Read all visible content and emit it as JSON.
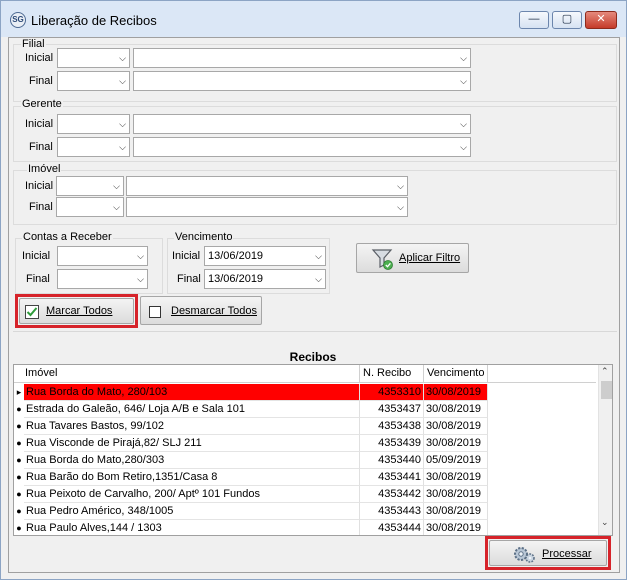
{
  "window": {
    "title": "Liberação de Recibos",
    "app_icon_text": "SG",
    "minimize": "—",
    "maximize": "▢",
    "close": "✕"
  },
  "filial": {
    "label": "Filial",
    "inicial_label": "Inicial",
    "final_label": "Final"
  },
  "gerente": {
    "label": "Gerente",
    "inicial_label": "Inicial",
    "final_label": "Final"
  },
  "imovel": {
    "label": "Imóvel",
    "inicial_label": "Inicial",
    "final_label": "Final"
  },
  "contas": {
    "label": "Contas a Receber",
    "inicial_label": "Inicial",
    "final_label": "Final"
  },
  "vencimento": {
    "label": "Vencimento",
    "inicial_label": "Inicial",
    "final_label": "Final",
    "inicial_value": "13/06/2019",
    "final_value": "13/06/2019"
  },
  "buttons": {
    "aplicar_filtro": "Aplicar Filtro",
    "marcar_todos": "Marcar Todos",
    "desmarcar_todos": "Desmarcar Todos",
    "processar": "Processar"
  },
  "grid": {
    "title": "Recibos",
    "columns": [
      "Imóvel",
      "N. Recibo",
      "Vencimento"
    ],
    "rows": [
      {
        "imovel": "Rua  Borda do Mato, 280/103",
        "recibo": "4353310",
        "venc": "30/08/2019"
      },
      {
        "imovel": "Estrada do Galeão, 646/ Loja A/B e Sala 101",
        "recibo": "4353437",
        "venc": "30/08/2019"
      },
      {
        "imovel": "Rua Tavares Bastos, 99/102",
        "recibo": "4353438",
        "venc": "30/08/2019"
      },
      {
        "imovel": "Rua Visconde de Pirajá,82/ SLJ 211",
        "recibo": "4353439",
        "venc": "30/08/2019"
      },
      {
        "imovel": "Rua Borda do Mato,280/303",
        "recibo": "4353440",
        "venc": "05/09/2019"
      },
      {
        "imovel": "Rua Barão do Bom Retiro,1351/Casa 8",
        "recibo": "4353441",
        "venc": "30/08/2019"
      },
      {
        "imovel": "Rua Peixoto de Carvalho, 200/ Aptº 101 Fundos",
        "recibo": "4353442",
        "venc": "30/08/2019"
      },
      {
        "imovel": "Rua Pedro Américo, 348/1005",
        "recibo": "4353443",
        "venc": "30/08/2019"
      },
      {
        "imovel": "Rua Paulo Alves,144 / 1303",
        "recibo": "4353444",
        "venc": "30/08/2019"
      }
    ]
  },
  "colors": {
    "selected_row": "#ff0000",
    "highlight_box": "#d6232a"
  }
}
